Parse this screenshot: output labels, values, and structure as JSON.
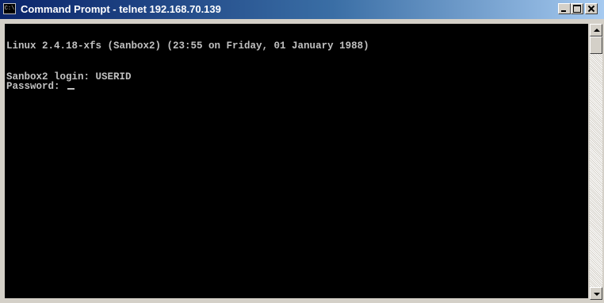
{
  "window": {
    "title": "Command Prompt - telnet 192.168.70.139",
    "icon": "command-prompt-icon",
    "icon_glyph": "C:\\"
  },
  "terminal": {
    "lines": [
      "Linux 2.4.18-xfs (Sanbox2) (23:55 on Friday, 01 January 1988)",
      "Sanbox2 login: USERID",
      "Password: "
    ],
    "colors": {
      "background": "#000000",
      "text": "#c0c0c0"
    }
  },
  "controls": {
    "minimize": "minimize-icon",
    "maximize": "maximize-icon",
    "close": "close-icon"
  }
}
